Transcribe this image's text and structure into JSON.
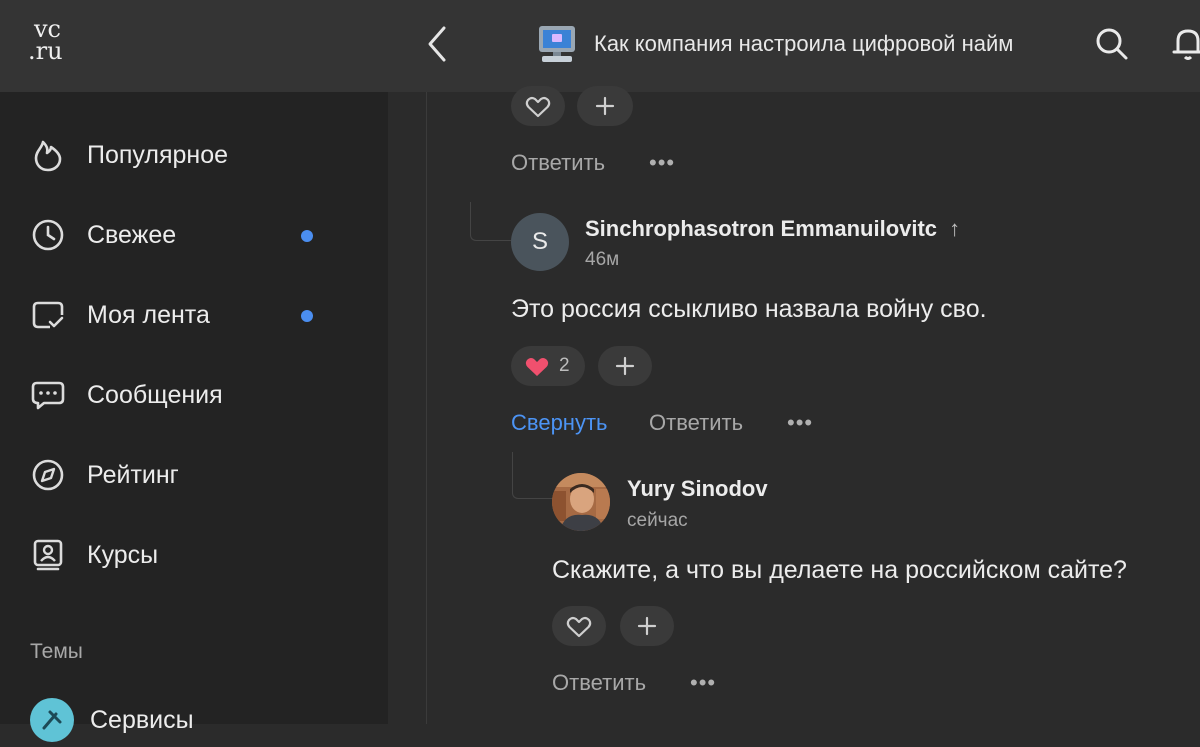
{
  "header": {
    "logo_line1": "vc",
    "logo_line2": ".ru",
    "post_title": "Как компания настроила цифровой найм"
  },
  "sidebar": {
    "items": [
      {
        "label": "Популярное",
        "icon": "flame-icon",
        "dot": false
      },
      {
        "label": "Свежее",
        "icon": "clock-icon",
        "dot": true
      },
      {
        "label": "Моя лента",
        "icon": "feed-check-icon",
        "dot": true
      },
      {
        "label": "Сообщения",
        "icon": "chat-bubble-icon",
        "dot": false
      },
      {
        "label": "Рейтинг",
        "icon": "compass-icon",
        "dot": false
      },
      {
        "label": "Курсы",
        "icon": "user-card-icon",
        "dot": false
      }
    ],
    "section_title": "Темы",
    "topic_label": "Сервисы"
  },
  "content": {
    "top_actions": {
      "reply": "Ответить",
      "more": "•••"
    },
    "comment1": {
      "avatar_letter": "S",
      "author": "Sinchrophasotron Emmanuilovitc",
      "author_badge": "↑",
      "time": "46м",
      "text": "Это россия ссыкливо назвала войну сво.",
      "like_count": "2",
      "collapse": "Свернуть",
      "reply": "Ответить",
      "more": "•••"
    },
    "comment2": {
      "author": "Yury Sinodov",
      "time": "сейчас",
      "text": "Скажите, а что вы делаете на российском сайте?",
      "reply": "Ответить",
      "more": "•••"
    }
  },
  "colors": {
    "accent_blue": "#4c94f5",
    "heart_red": "#f0506e",
    "background": "#2b2b2b",
    "sidebar": "#232323",
    "header": "#343434"
  }
}
